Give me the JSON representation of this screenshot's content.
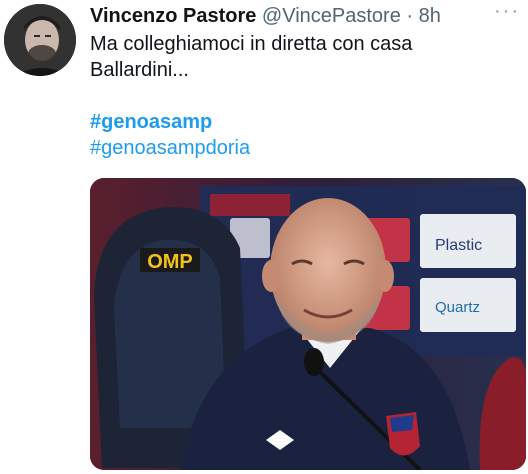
{
  "tweet": {
    "author_name": "Vincenzo Pastore",
    "author_handle": "@VincePastore",
    "separator": "·",
    "timestamp": "8h",
    "text_line1": "Ma colleghiamoci in diretta con casa",
    "text_line2": "Ballardini...",
    "hashtags": [
      "#genoasamp",
      "#genoasampdoria"
    ],
    "more_icon": "more-options-icon"
  },
  "media": {
    "sponsor_logo_text": "OMP",
    "backdrop_texts": [
      "Plastic",
      "Quartz"
    ]
  }
}
